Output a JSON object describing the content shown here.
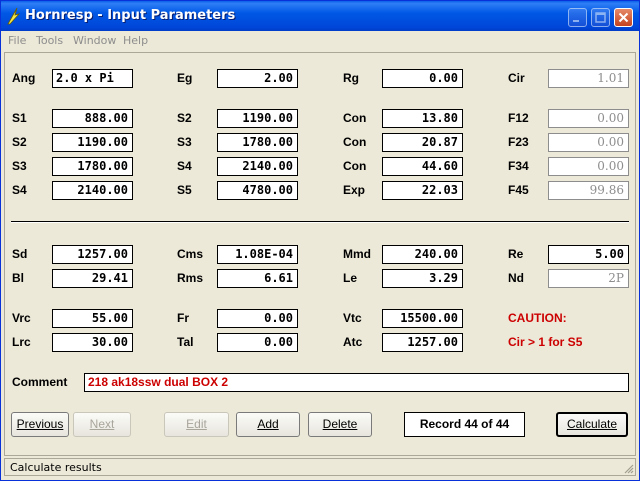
{
  "window": {
    "title": "Hornresp - Input Parameters"
  },
  "menu": [
    "File",
    "Tools",
    "Window",
    "Help"
  ],
  "params": {
    "Ang": {
      "label": "Ang",
      "value": "2.0 x Pi"
    },
    "Eg": {
      "label": "Eg",
      "value": "2.00"
    },
    "Rg": {
      "label": "Rg",
      "value": "0.00"
    },
    "Cir": {
      "label": "Cir",
      "value": "1.01"
    },
    "S1a": {
      "label": "S1",
      "value": "888.00"
    },
    "S2a": {
      "label": "S2",
      "value": "1190.00"
    },
    "Con1": {
      "label": "Con",
      "value": "13.80"
    },
    "F12": {
      "label": "F12",
      "value": "0.00"
    },
    "S2b": {
      "label": "S2",
      "value": "1190.00"
    },
    "S3a": {
      "label": "S3",
      "value": "1780.00"
    },
    "Con2": {
      "label": "Con",
      "value": "20.87"
    },
    "F23": {
      "label": "F23",
      "value": "0.00"
    },
    "S3b": {
      "label": "S3",
      "value": "1780.00"
    },
    "S4a": {
      "label": "S4",
      "value": "2140.00"
    },
    "Con3": {
      "label": "Con",
      "value": "44.60"
    },
    "F34": {
      "label": "F34",
      "value": "0.00"
    },
    "S4b": {
      "label": "S4",
      "value": "2140.00"
    },
    "S5": {
      "label": "S5",
      "value": "4780.00"
    },
    "Exp": {
      "label": "Exp",
      "value": "22.03"
    },
    "F45": {
      "label": "F45",
      "value": "99.86"
    },
    "Sd": {
      "label": "Sd",
      "value": "1257.00"
    },
    "Cms": {
      "label": "Cms",
      "value": "1.08E-04"
    },
    "Mmd": {
      "label": "Mmd",
      "value": "240.00"
    },
    "Re": {
      "label": "Re",
      "value": "5.00"
    },
    "Bl": {
      "label": "Bl",
      "value": "29.41"
    },
    "Rms": {
      "label": "Rms",
      "value": "6.61"
    },
    "Le": {
      "label": "Le",
      "value": "3.29"
    },
    "Nd": {
      "label": "Nd",
      "value": "2P"
    },
    "Vrc": {
      "label": "Vrc",
      "value": "55.00"
    },
    "Fr": {
      "label": "Fr",
      "value": "0.00"
    },
    "Vtc": {
      "label": "Vtc",
      "value": "15500.00"
    },
    "Lrc": {
      "label": "Lrc",
      "value": "30.00"
    },
    "Tal": {
      "label": "Tal",
      "value": "0.00"
    },
    "Atc": {
      "label": "Atc",
      "value": "1257.00"
    }
  },
  "caution": {
    "heading": "CAUTION:",
    "message": "Cir > 1 for S5"
  },
  "comment": {
    "label": "Comment",
    "value": "218 ak18ssw dual BOX 2"
  },
  "buttons": {
    "previous": "Previous",
    "next": "Next",
    "edit": "Edit",
    "add": "Add",
    "delete": "Delete",
    "calculate": "Calculate"
  },
  "record": "Record 44 of 44",
  "status": "Calculate results",
  "colors": {
    "titlebar": "#0058e5",
    "caution": "#cc0000",
    "face": "#ece9d8"
  }
}
